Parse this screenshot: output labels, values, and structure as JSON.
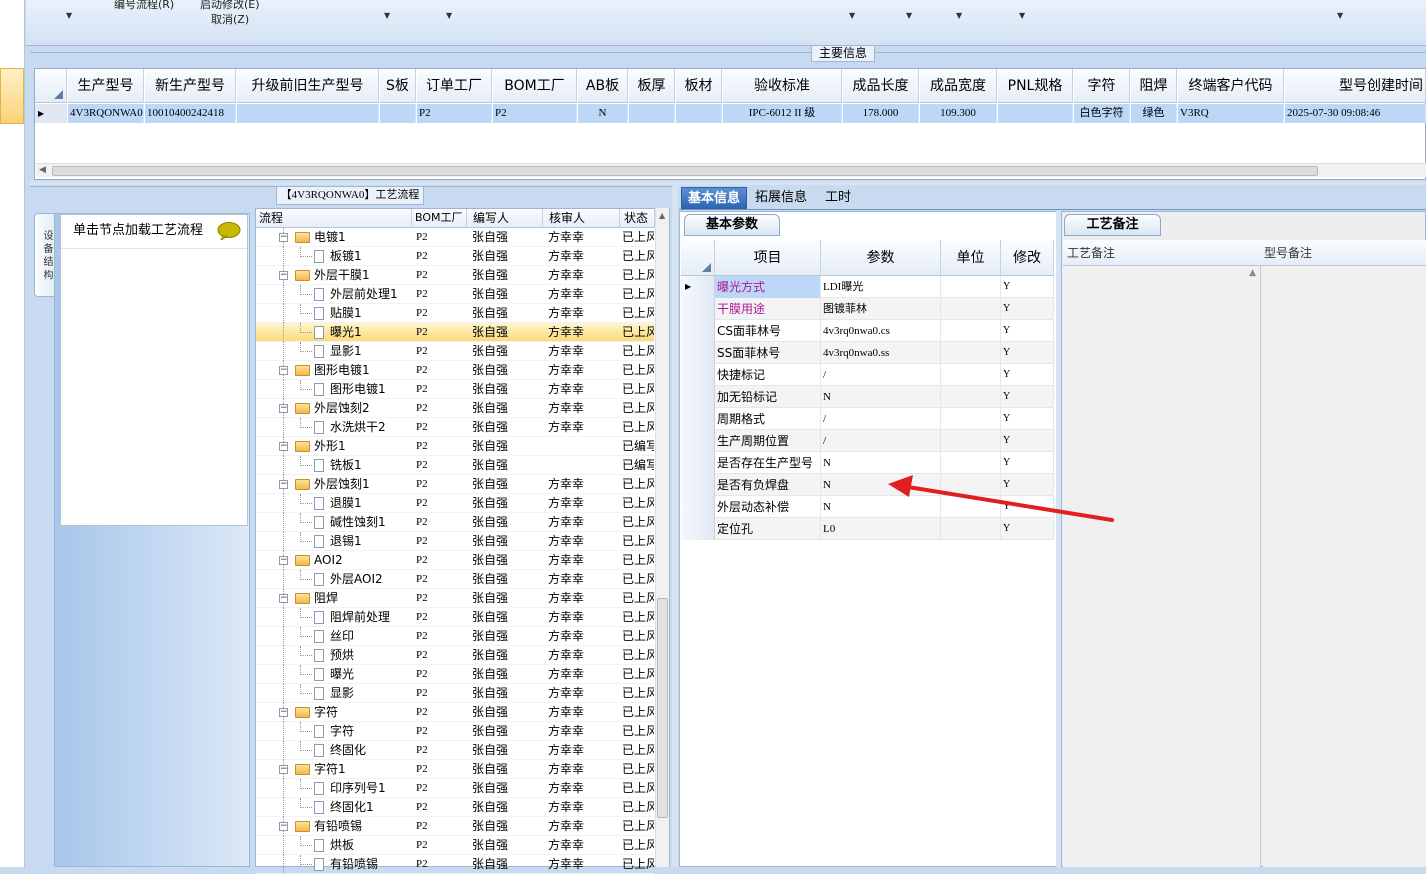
{
  "toolbar": {
    "menu_texts": [
      "编号流程(R)",
      "启动修改(E)",
      "取消(Z)"
    ]
  },
  "main_info": {
    "group_title": "主要信息",
    "columns": [
      "生产型号",
      "新生产型号",
      "升级前旧生产型号",
      "S板",
      "订单工厂",
      "BOM工厂",
      "AB板",
      "板厚",
      "板材",
      "验收标准",
      "成品长度",
      "成品宽度",
      "PNL规格",
      "字符",
      "阻焊",
      "终端客户代码",
      "型号创建时间"
    ],
    "row": [
      "4V3RQONWA0",
      "10010400242418",
      "",
      "",
      "P2",
      "P2",
      "N",
      "",
      "",
      "IPC-6012 II 级",
      "178.000",
      "109.300",
      "",
      "白色字符",
      "绿色",
      "V3RQ",
      "2025-07-30 09:08:46"
    ]
  },
  "flow_panel": {
    "title": "【4V3RQONWA0】工艺流程",
    "side_tab": "设 备 结 构",
    "nav_hint": "单击节点加载工艺流程",
    "columns": [
      "流程",
      "BOM工厂",
      "编写人",
      "核审人",
      "状态"
    ],
    "rows": [
      {
        "name": "电镀1",
        "bom": "P2",
        "author": "张自强",
        "reviewer": "方幸幸",
        "status": "已上风"
      },
      {
        "name": "板镀1",
        "bom": "P2",
        "author": "张自强",
        "reviewer": "方幸幸",
        "status": "已上风"
      },
      {
        "name": "外层干膜1",
        "bom": "P2",
        "author": "张自强",
        "reviewer": "方幸幸",
        "status": "已上风"
      },
      {
        "name": "外层前处理1",
        "bom": "P2",
        "author": "张自强",
        "reviewer": "方幸幸",
        "status": "已上风"
      },
      {
        "name": "贴膜1",
        "bom": "P2",
        "author": "张自强",
        "reviewer": "方幸幸",
        "status": "已上风"
      },
      {
        "name": "曝光1",
        "bom": "P2",
        "author": "张自强",
        "reviewer": "方幸幸",
        "status": "已上风"
      },
      {
        "name": "显影1",
        "bom": "P2",
        "author": "张自强",
        "reviewer": "方幸幸",
        "status": "已上风"
      },
      {
        "name": "图形电镀1",
        "bom": "P2",
        "author": "张自强",
        "reviewer": "方幸幸",
        "status": "已上风"
      },
      {
        "name": "图形电镀1",
        "bom": "P2",
        "author": "张自强",
        "reviewer": "方幸幸",
        "status": "已上风"
      },
      {
        "name": "外层蚀刻2",
        "bom": "P2",
        "author": "张自强",
        "reviewer": "方幸幸",
        "status": "已上风"
      },
      {
        "name": "水洗烘干2",
        "bom": "P2",
        "author": "张自强",
        "reviewer": "方幸幸",
        "status": "已上风"
      },
      {
        "name": "外形1",
        "bom": "P2",
        "author": "张自强",
        "reviewer": "",
        "status": "已编写"
      },
      {
        "name": "铣板1",
        "bom": "P2",
        "author": "张自强",
        "reviewer": "",
        "status": "已编写"
      },
      {
        "name": "外层蚀刻1",
        "bom": "P2",
        "author": "张自强",
        "reviewer": "方幸幸",
        "status": "已上风"
      },
      {
        "name": "退膜1",
        "bom": "P2",
        "author": "张自强",
        "reviewer": "方幸幸",
        "status": "已上风"
      },
      {
        "name": "碱性蚀刻1",
        "bom": "P2",
        "author": "张自强",
        "reviewer": "方幸幸",
        "status": "已上风"
      },
      {
        "name": "退锡1",
        "bom": "P2",
        "author": "张自强",
        "reviewer": "方幸幸",
        "status": "已上风"
      },
      {
        "name": "AOI2",
        "bom": "P2",
        "author": "张自强",
        "reviewer": "方幸幸",
        "status": "已上风"
      },
      {
        "name": "外层AOI2",
        "bom": "P2",
        "author": "张自强",
        "reviewer": "方幸幸",
        "status": "已上风"
      },
      {
        "name": "阻焊",
        "bom": "P2",
        "author": "张自强",
        "reviewer": "方幸幸",
        "status": "已上风"
      },
      {
        "name": "阻焊前处理",
        "bom": "P2",
        "author": "张自强",
        "reviewer": "方幸幸",
        "status": "已上风"
      },
      {
        "name": "丝印",
        "bom": "P2",
        "author": "张自强",
        "reviewer": "方幸幸",
        "status": "已上风"
      },
      {
        "name": "预烘",
        "bom": "P2",
        "author": "张自强",
        "reviewer": "方幸幸",
        "status": "已上风"
      },
      {
        "name": "曝光",
        "bom": "P2",
        "author": "张自强",
        "reviewer": "方幸幸",
        "status": "已上风"
      },
      {
        "name": "显影",
        "bom": "P2",
        "author": "张自强",
        "reviewer": "方幸幸",
        "status": "已上风"
      },
      {
        "name": "字符",
        "bom": "P2",
        "author": "张自强",
        "reviewer": "方幸幸",
        "status": "已上风"
      },
      {
        "name": "字符",
        "bom": "P2",
        "author": "张自强",
        "reviewer": "方幸幸",
        "status": "已上风"
      },
      {
        "name": "终固化",
        "bom": "P2",
        "author": "张自强",
        "reviewer": "方幸幸",
        "status": "已上风"
      },
      {
        "name": "字符1",
        "bom": "P2",
        "author": "张自强",
        "reviewer": "方幸幸",
        "status": "已上风"
      },
      {
        "name": "印序列号1",
        "bom": "P2",
        "author": "张自强",
        "reviewer": "方幸幸",
        "status": "已上风"
      },
      {
        "name": "终固化1",
        "bom": "P2",
        "author": "张自强",
        "reviewer": "方幸幸",
        "status": "已上风"
      },
      {
        "name": "有铅喷锡",
        "bom": "P2",
        "author": "张自强",
        "reviewer": "方幸幸",
        "status": "已上风"
      },
      {
        "name": "烘板",
        "bom": "P2",
        "author": "张自强",
        "reviewer": "方幸幸",
        "status": "已上风"
      },
      {
        "name": "有铅喷锡",
        "bom": "P2",
        "author": "张自强",
        "reviewer": "方幸幸",
        "status": "已上风"
      }
    ]
  },
  "right_tabs": [
    "基本信息",
    "拓展信息",
    "工时"
  ],
  "params": {
    "tab_label": "基本参数",
    "columns": [
      "项目",
      "参数",
      "单位",
      "修改"
    ],
    "rows": [
      {
        "item": "曝光方式",
        "value": "LDI曝光",
        "unit": "",
        "modify": "Y"
      },
      {
        "item": "干膜用途",
        "value": "图镀菲林",
        "unit": "",
        "modify": "Y"
      },
      {
        "item": "CS面菲林号",
        "value": "4v3rq0nwa0.cs",
        "unit": "",
        "modify": "Y"
      },
      {
        "item": "SS面菲林号",
        "value": "4v3rq0nwa0.ss",
        "unit": "",
        "modify": "Y"
      },
      {
        "item": "快捷标记",
        "value": "/",
        "unit": "",
        "modify": "Y"
      },
      {
        "item": "加无铅标记",
        "value": "N",
        "unit": "",
        "modify": "Y"
      },
      {
        "item": "周期格式",
        "value": "/",
        "unit": "",
        "modify": "Y"
      },
      {
        "item": "生产周期位置",
        "value": "/",
        "unit": "",
        "modify": "Y"
      },
      {
        "item": "是否存在生产型号",
        "value": "N",
        "unit": "",
        "modify": "Y"
      },
      {
        "item": "是否有负焊盘",
        "value": "N",
        "unit": "",
        "modify": "Y"
      },
      {
        "item": "外层动态补偿",
        "value": "N",
        "unit": "",
        "modify": "Y"
      },
      {
        "item": "定位孔",
        "value": "L0",
        "unit": "",
        "modify": "Y"
      }
    ]
  },
  "remarks": {
    "tab_label": "工艺备注",
    "col_process": "工艺备注",
    "col_model": "型号备注"
  },
  "colors": {
    "highlight_item": "#b0179a",
    "annotation_arrow": "#e02020",
    "selected_row": "#bcd8f6",
    "selected_tree_row": "#fbdb77",
    "active_tab": "#2d66b3"
  }
}
